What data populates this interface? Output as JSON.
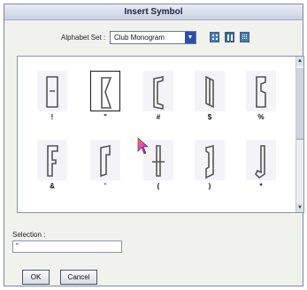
{
  "dialog": {
    "title": "Insert Symbol"
  },
  "alphabet": {
    "label": "Alphabet Set :",
    "value": "Club Monogram",
    "arrow": "▼"
  },
  "view_buttons": [
    "grid-large-icon",
    "grid-columns-icon",
    "grid-small-icon"
  ],
  "symbols": [
    {
      "char": "!",
      "caption": "!"
    },
    {
      "char": "\"",
      "caption": "\"",
      "selected": true
    },
    {
      "char": "#",
      "caption": "#"
    },
    {
      "char": "$",
      "caption": "$"
    },
    {
      "char": "%",
      "caption": "%"
    },
    {
      "char": "&",
      "caption": "&"
    },
    {
      "char": "'",
      "caption": "'"
    },
    {
      "char": "(",
      "caption": "("
    },
    {
      "char": ")",
      "caption": ")"
    },
    {
      "char": "*",
      "caption": "*"
    }
  ],
  "scrollbar": {
    "up": "▲",
    "down": "▼"
  },
  "selection": {
    "label": "Selection :",
    "value": "\""
  },
  "buttons": {
    "ok": "OK",
    "cancel": "Cancel"
  }
}
